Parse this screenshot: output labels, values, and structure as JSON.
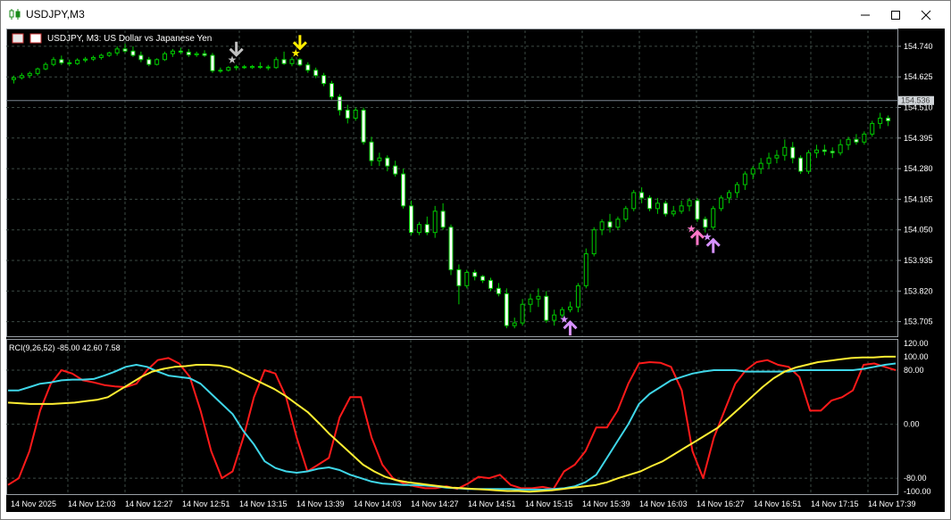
{
  "window": {
    "title": "USDJPY,M3",
    "controls": {
      "minimize_icon": "minimize-icon",
      "maximize_icon": "maximize-icon",
      "close_icon": "close-icon"
    }
  },
  "chart": {
    "header_label": "USDJPY, M3:  US Dollar vs Japanese Yen",
    "current_price": "154.536",
    "price_labels": [
      "154.740",
      "154.625",
      "154.510",
      "154.395",
      "154.280",
      "154.165",
      "154.050",
      "153.935",
      "153.820",
      "153.705"
    ],
    "indicator_label": "RCI(9,26,52) -85.00 42.60 7.58",
    "indicator_scale_labels": [
      "120.00",
      "100.00",
      "80.00",
      "0.00",
      "-80.00",
      "-100.00"
    ],
    "time_labels": [
      "14 Nov 2025",
      "14 Nov 12:03",
      "14 Nov 12:27",
      "14 Nov 12:51",
      "14 Nov 13:15",
      "14 Nov 13:39",
      "14 Nov 14:03",
      "14 Nov 14:27",
      "14 Nov 14:51",
      "14 Nov 15:15",
      "14 Nov 15:39",
      "14 Nov 16:03",
      "14 Nov 16:27",
      "14 Nov 16:51",
      "14 Nov 17:15",
      "14 Nov 17:39"
    ],
    "colors": {
      "background": "#000000",
      "grid": "#3c4a44",
      "candle": "#00cc00",
      "candle_bull_body": "#000000",
      "candle_bear_body": "#ffffff",
      "rci_short": "#ff1a1a",
      "rci_mid": "#3fd6e8",
      "rci_long": "#ffee33",
      "signal_yellow": "#ffee00",
      "signal_grey": "#c0c0c0",
      "signal_pink": "#ff77c8",
      "signal_violet": "#d690ff",
      "current_price_line": "#7a8590"
    }
  },
  "chart_data": {
    "type": "candlestick",
    "symbol": "USDJPY",
    "timeframe": "M3",
    "ylim": [
      153.65,
      154.8
    ],
    "rci": {
      "ylim": [
        -105,
        125
      ],
      "levels": [
        120,
        100,
        80,
        0,
        -80,
        -100
      ],
      "series": [
        {
          "name": "RCI 9",
          "color": "#ff1a1a",
          "values": [
            -90,
            -80,
            -40,
            20,
            60,
            80,
            75,
            65,
            62,
            58,
            56,
            55,
            60,
            80,
            95,
            98,
            90,
            70,
            20,
            -40,
            -80,
            -70,
            -20,
            40,
            80,
            75,
            40,
            -20,
            -70,
            -60,
            -50,
            10,
            40,
            40,
            -20,
            -60,
            -80,
            -88,
            -92,
            -95,
            -95,
            -92,
            -96,
            -88,
            -78,
            -80,
            -75,
            -90,
            -95,
            -95,
            -93,
            -96,
            -70,
            -60,
            -40,
            -5,
            -5,
            20,
            60,
            90,
            92,
            91,
            85,
            50,
            -40,
            -80,
            -20,
            20,
            60,
            80,
            92,
            95,
            88,
            85,
            70,
            20,
            20,
            35,
            40,
            50,
            88,
            90,
            85,
            80
          ]
        },
        {
          "name": "RCI 26",
          "color": "#3fd6e8",
          "values": [
            50,
            50,
            55,
            60,
            62,
            65,
            66,
            66,
            67,
            72,
            78,
            85,
            88,
            85,
            78,
            72,
            70,
            68,
            60,
            45,
            30,
            15,
            -10,
            -30,
            -55,
            -65,
            -70,
            -72,
            -70,
            -66,
            -64,
            -68,
            -75,
            -80,
            -85,
            -88,
            -89,
            -90,
            -90,
            -91,
            -92,
            -94,
            -95,
            -96,
            -96,
            -96,
            -96,
            -96,
            -97,
            -97,
            -97,
            -96,
            -95,
            -92,
            -86,
            -75,
            -50,
            -25,
            0,
            30,
            45,
            55,
            65,
            70,
            75,
            78,
            80,
            80,
            80,
            78,
            78,
            78,
            78,
            78,
            80,
            80,
            80,
            80,
            80,
            80,
            82,
            85,
            88,
            90
          ]
        },
        {
          "name": "RCI 52",
          "color": "#ffee33",
          "values": [
            32,
            31,
            30,
            30,
            30,
            31,
            32,
            34,
            36,
            40,
            50,
            60,
            70,
            78,
            82,
            85,
            86,
            88,
            88,
            87,
            84,
            76,
            68,
            60,
            52,
            42,
            30,
            18,
            2,
            -15,
            -30,
            -45,
            -60,
            -70,
            -78,
            -83,
            -86,
            -88,
            -90,
            -92,
            -94,
            -95,
            -96,
            -97,
            -98,
            -99,
            -99,
            -100,
            -99,
            -98,
            -96,
            -94,
            -92,
            -90,
            -86,
            -80,
            -75,
            -70,
            -62,
            -55,
            -45,
            -35,
            -25,
            -15,
            -5,
            10,
            25,
            40,
            55,
            68,
            78,
            84,
            88,
            92,
            94,
            96,
            98,
            99,
            99,
            100,
            100
          ]
        }
      ]
    },
    "signals": [
      {
        "type": "down-arrow",
        "color": "yellow",
        "time": "14 Nov 13:27"
      },
      {
        "type": "down-arrow",
        "color": "grey",
        "time": "14 Nov 13:03"
      },
      {
        "type": "up-arrow",
        "color": "violet",
        "time": "14 Nov 15:27"
      },
      {
        "type": "up-arrow",
        "color": "pink",
        "time": "14 Nov 16:15"
      },
      {
        "type": "up-arrow",
        "color": "violet",
        "time": "14 Nov 16:21"
      }
    ],
    "candles": [
      {
        "o": 154.615,
        "h": 154.63,
        "l": 154.6,
        "c": 154.622
      },
      {
        "o": 154.622,
        "h": 154.64,
        "l": 154.615,
        "c": 154.63
      },
      {
        "o": 154.63,
        "h": 154.645,
        "l": 154.62,
        "c": 154.638
      },
      {
        "o": 154.638,
        "h": 154.66,
        "l": 154.63,
        "c": 154.655
      },
      {
        "o": 154.655,
        "h": 154.68,
        "l": 154.65,
        "c": 154.672
      },
      {
        "o": 154.672,
        "h": 154.7,
        "l": 154.665,
        "c": 154.69
      },
      {
        "o": 154.69,
        "h": 154.705,
        "l": 154.67,
        "c": 154.678
      },
      {
        "o": 154.678,
        "h": 154.69,
        "l": 154.665,
        "c": 154.675
      },
      {
        "o": 154.675,
        "h": 154.695,
        "l": 154.67,
        "c": 154.688
      },
      {
        "o": 154.688,
        "h": 154.7,
        "l": 154.68,
        "c": 154.692
      },
      {
        "o": 154.692,
        "h": 154.705,
        "l": 154.685,
        "c": 154.698
      },
      {
        "o": 154.698,
        "h": 154.712,
        "l": 154.69,
        "c": 154.706
      },
      {
        "o": 154.706,
        "h": 154.72,
        "l": 154.7,
        "c": 154.715
      },
      {
        "o": 154.715,
        "h": 154.74,
        "l": 154.705,
        "c": 154.73
      },
      {
        "o": 154.73,
        "h": 154.75,
        "l": 154.715,
        "c": 154.722
      },
      {
        "o": 154.722,
        "h": 154.74,
        "l": 154.7,
        "c": 154.706
      },
      {
        "o": 154.706,
        "h": 154.72,
        "l": 154.68,
        "c": 154.69
      },
      {
        "o": 154.69,
        "h": 154.7,
        "l": 154.665,
        "c": 154.672
      },
      {
        "o": 154.672,
        "h": 154.695,
        "l": 154.668,
        "c": 154.69
      },
      {
        "o": 154.69,
        "h": 154.72,
        "l": 154.685,
        "c": 154.712
      },
      {
        "o": 154.712,
        "h": 154.73,
        "l": 154.7,
        "c": 154.722
      },
      {
        "o": 154.722,
        "h": 154.735,
        "l": 154.71,
        "c": 154.718
      },
      {
        "o": 154.718,
        "h": 154.73,
        "l": 154.7,
        "c": 154.708
      },
      {
        "o": 154.708,
        "h": 154.72,
        "l": 154.7,
        "c": 154.712
      },
      {
        "o": 154.712,
        "h": 154.725,
        "l": 154.7,
        "c": 154.706
      },
      {
        "o": 154.706,
        "h": 154.715,
        "l": 154.64,
        "c": 154.648
      },
      {
        "o": 154.648,
        "h": 154.66,
        "l": 154.64,
        "c": 154.65
      },
      {
        "o": 154.65,
        "h": 154.665,
        "l": 154.645,
        "c": 154.66
      },
      {
        "o": 154.66,
        "h": 154.67,
        "l": 154.65,
        "c": 154.663
      },
      {
        "o": 154.663,
        "h": 154.67,
        "l": 154.655,
        "c": 154.66
      },
      {
        "o": 154.66,
        "h": 154.67,
        "l": 154.655,
        "c": 154.664
      },
      {
        "o": 154.664,
        "h": 154.68,
        "l": 154.655,
        "c": 154.662
      },
      {
        "o": 154.662,
        "h": 154.67,
        "l": 154.65,
        "c": 154.66
      },
      {
        "o": 154.66,
        "h": 154.7,
        "l": 154.655,
        "c": 154.69
      },
      {
        "o": 154.69,
        "h": 154.72,
        "l": 154.67,
        "c": 154.675
      },
      {
        "o": 154.675,
        "h": 154.7,
        "l": 154.665,
        "c": 154.69
      },
      {
        "o": 154.69,
        "h": 154.695,
        "l": 154.665,
        "c": 154.67
      },
      {
        "o": 154.67,
        "h": 154.68,
        "l": 154.64,
        "c": 154.65
      },
      {
        "o": 154.65,
        "h": 154.66,
        "l": 154.62,
        "c": 154.63
      },
      {
        "o": 154.63,
        "h": 154.64,
        "l": 154.59,
        "c": 154.6
      },
      {
        "o": 154.6,
        "h": 154.61,
        "l": 154.54,
        "c": 154.55
      },
      {
        "o": 154.55,
        "h": 154.56,
        "l": 154.48,
        "c": 154.5
      },
      {
        "o": 154.5,
        "h": 154.52,
        "l": 154.45,
        "c": 154.47
      },
      {
        "o": 154.47,
        "h": 154.51,
        "l": 154.46,
        "c": 154.5
      },
      {
        "o": 154.5,
        "h": 154.51,
        "l": 154.37,
        "c": 154.38
      },
      {
        "o": 154.38,
        "h": 154.4,
        "l": 154.29,
        "c": 154.31
      },
      {
        "o": 154.31,
        "h": 154.34,
        "l": 154.29,
        "c": 154.32
      },
      {
        "o": 154.32,
        "h": 154.33,
        "l": 154.27,
        "c": 154.29
      },
      {
        "o": 154.29,
        "h": 154.31,
        "l": 154.25,
        "c": 154.26
      },
      {
        "o": 154.26,
        "h": 154.28,
        "l": 154.13,
        "c": 154.14
      },
      {
        "o": 154.14,
        "h": 154.16,
        "l": 154.03,
        "c": 154.04
      },
      {
        "o": 154.04,
        "h": 154.08,
        "l": 154.03,
        "c": 154.07
      },
      {
        "o": 154.07,
        "h": 154.1,
        "l": 154.03,
        "c": 154.04
      },
      {
        "o": 154.04,
        "h": 154.14,
        "l": 154.02,
        "c": 154.12
      },
      {
        "o": 154.12,
        "h": 154.15,
        "l": 154.05,
        "c": 154.06
      },
      {
        "o": 154.06,
        "h": 154.07,
        "l": 153.88,
        "c": 153.9
      },
      {
        "o": 153.9,
        "h": 153.92,
        "l": 153.77,
        "c": 153.84
      },
      {
        "o": 153.84,
        "h": 153.9,
        "l": 153.83,
        "c": 153.89
      },
      {
        "o": 153.89,
        "h": 153.9,
        "l": 153.86,
        "c": 153.875
      },
      {
        "o": 153.875,
        "h": 153.88,
        "l": 153.85,
        "c": 153.86
      },
      {
        "o": 153.86,
        "h": 153.87,
        "l": 153.82,
        "c": 153.83
      },
      {
        "o": 153.83,
        "h": 153.85,
        "l": 153.8,
        "c": 153.81
      },
      {
        "o": 153.81,
        "h": 153.83,
        "l": 153.68,
        "c": 153.69
      },
      {
        "o": 153.69,
        "h": 153.72,
        "l": 153.68,
        "c": 153.7
      },
      {
        "o": 153.7,
        "h": 153.79,
        "l": 153.69,
        "c": 153.77
      },
      {
        "o": 153.77,
        "h": 153.81,
        "l": 153.74,
        "c": 153.79
      },
      {
        "o": 153.79,
        "h": 153.83,
        "l": 153.76,
        "c": 153.8
      },
      {
        "o": 153.8,
        "h": 153.82,
        "l": 153.7,
        "c": 153.71
      },
      {
        "o": 153.71,
        "h": 153.75,
        "l": 153.69,
        "c": 153.73
      },
      {
        "o": 153.73,
        "h": 153.76,
        "l": 153.72,
        "c": 153.75
      },
      {
        "o": 153.75,
        "h": 153.78,
        "l": 153.74,
        "c": 153.76
      },
      {
        "o": 153.76,
        "h": 153.85,
        "l": 153.74,
        "c": 153.84
      },
      {
        "o": 153.84,
        "h": 153.98,
        "l": 153.83,
        "c": 153.96
      },
      {
        "o": 153.96,
        "h": 154.06,
        "l": 153.95,
        "c": 154.05
      },
      {
        "o": 154.05,
        "h": 154.09,
        "l": 154.03,
        "c": 154.08
      },
      {
        "o": 154.08,
        "h": 154.11,
        "l": 154.04,
        "c": 154.06
      },
      {
        "o": 154.06,
        "h": 154.1,
        "l": 154.05,
        "c": 154.09
      },
      {
        "o": 154.09,
        "h": 154.14,
        "l": 154.08,
        "c": 154.13
      },
      {
        "o": 154.13,
        "h": 154.2,
        "l": 154.12,
        "c": 154.19
      },
      {
        "o": 154.19,
        "h": 154.21,
        "l": 154.15,
        "c": 154.17
      },
      {
        "o": 154.17,
        "h": 154.18,
        "l": 154.12,
        "c": 154.13
      },
      {
        "o": 154.13,
        "h": 154.17,
        "l": 154.11,
        "c": 154.15
      },
      {
        "o": 154.15,
        "h": 154.16,
        "l": 154.1,
        "c": 154.11
      },
      {
        "o": 154.11,
        "h": 154.14,
        "l": 154.1,
        "c": 154.12
      },
      {
        "o": 154.12,
        "h": 154.16,
        "l": 154.11,
        "c": 154.14
      },
      {
        "o": 154.14,
        "h": 154.17,
        "l": 154.12,
        "c": 154.16
      },
      {
        "o": 154.16,
        "h": 154.17,
        "l": 154.08,
        "c": 154.09
      },
      {
        "o": 154.09,
        "h": 154.1,
        "l": 154.04,
        "c": 154.06
      },
      {
        "o": 154.06,
        "h": 154.14,
        "l": 154.05,
        "c": 154.13
      },
      {
        "o": 154.13,
        "h": 154.18,
        "l": 154.12,
        "c": 154.17
      },
      {
        "o": 154.17,
        "h": 154.2,
        "l": 154.15,
        "c": 154.19
      },
      {
        "o": 154.19,
        "h": 154.23,
        "l": 154.17,
        "c": 154.22
      },
      {
        "o": 154.22,
        "h": 154.27,
        "l": 154.2,
        "c": 154.26
      },
      {
        "o": 154.26,
        "h": 154.29,
        "l": 154.24,
        "c": 154.28
      },
      {
        "o": 154.28,
        "h": 154.32,
        "l": 154.26,
        "c": 154.3
      },
      {
        "o": 154.3,
        "h": 154.34,
        "l": 154.28,
        "c": 154.32
      },
      {
        "o": 154.32,
        "h": 154.35,
        "l": 154.3,
        "c": 154.33
      },
      {
        "o": 154.33,
        "h": 154.39,
        "l": 154.31,
        "c": 154.36
      },
      {
        "o": 154.36,
        "h": 154.38,
        "l": 154.3,
        "c": 154.32
      },
      {
        "o": 154.32,
        "h": 154.33,
        "l": 154.26,
        "c": 154.27
      },
      {
        "o": 154.27,
        "h": 154.35,
        "l": 154.26,
        "c": 154.34
      },
      {
        "o": 154.34,
        "h": 154.37,
        "l": 154.32,
        "c": 154.35
      },
      {
        "o": 154.35,
        "h": 154.37,
        "l": 154.33,
        "c": 154.345
      },
      {
        "o": 154.345,
        "h": 154.36,
        "l": 154.32,
        "c": 154.34
      },
      {
        "o": 154.34,
        "h": 154.39,
        "l": 154.33,
        "c": 154.37
      },
      {
        "o": 154.37,
        "h": 154.4,
        "l": 154.35,
        "c": 154.39
      },
      {
        "o": 154.39,
        "h": 154.41,
        "l": 154.37,
        "c": 154.38
      },
      {
        "o": 154.38,
        "h": 154.42,
        "l": 154.37,
        "c": 154.41
      },
      {
        "o": 154.41,
        "h": 154.46,
        "l": 154.4,
        "c": 154.45
      },
      {
        "o": 154.45,
        "h": 154.49,
        "l": 154.43,
        "c": 154.47
      },
      {
        "o": 154.47,
        "h": 154.48,
        "l": 154.44,
        "c": 154.46
      }
    ]
  }
}
